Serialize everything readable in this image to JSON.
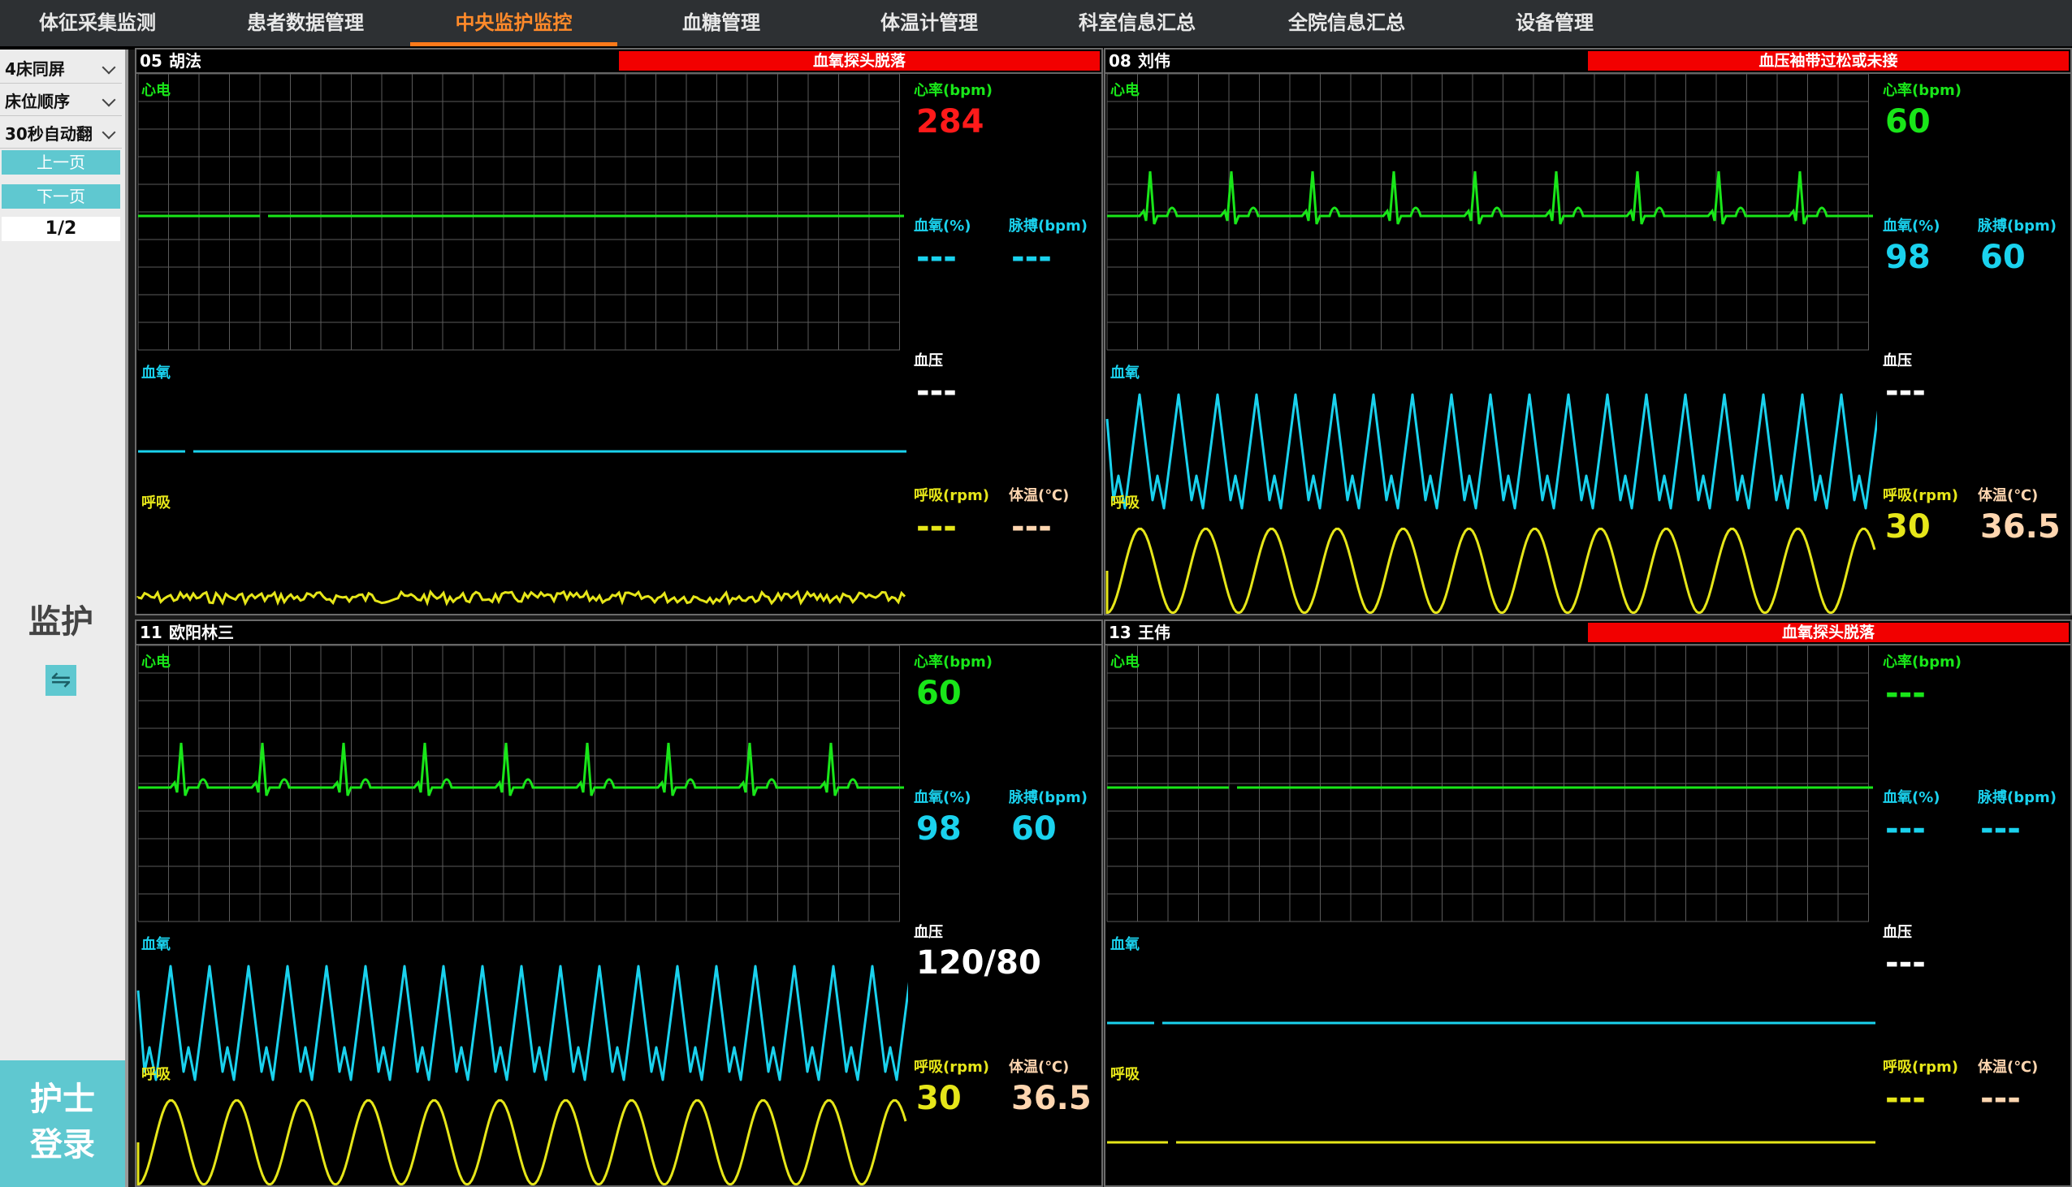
{
  "nav": {
    "tabs": [
      "体征采集监测",
      "患者数据管理",
      "中央监护监控",
      "血糖管理",
      "体温计管理",
      "科室信息汇总",
      "全院信息汇总",
      "设备管理"
    ],
    "active_index": 2
  },
  "sidebar": {
    "layout_select": "4床同屏",
    "order_select": "床位顺序",
    "flip_select": "30秒自动翻",
    "prev_page": "上一页",
    "next_page": "下一页",
    "page_indicator": "1/2",
    "monitor_label": "监护",
    "swap_icon": "⇋",
    "nurse_login_line1": "护士",
    "nurse_login_line2": "登录"
  },
  "labels": {
    "ecg": "心电",
    "spo2_wave": "血氧",
    "resp_wave": "呼吸",
    "hr": "心率(bpm)",
    "spo2": "血氧(%)",
    "pulse": "脉搏(bpm)",
    "bp": "血压",
    "resp": "呼吸(rpm)",
    "temp": "体温(℃)"
  },
  "colors": {
    "ecg": "#19e619",
    "spo2": "#1ad2ee",
    "resp": "#e6e619",
    "alarm": "#f20000",
    "hr_alarm": "#ff1a1a",
    "active_tab": "#ff8a2a",
    "sidebar_button": "#5fc8d0"
  },
  "patients": [
    {
      "bed": "05",
      "name": "胡法",
      "alarm": "血氧探头脱落",
      "hr": "284",
      "hr_alarm": true,
      "spo2": "---",
      "pulse": "---",
      "bp": "---",
      "resp": "---",
      "temp": "---",
      "ecg_mode": "flat",
      "spo2_mode": "flat",
      "resp_mode": "noise"
    },
    {
      "bed": "08",
      "name": "刘伟",
      "alarm": "血压袖带过松或未接",
      "hr": "60",
      "hr_alarm": false,
      "spo2": "98",
      "pulse": "60",
      "bp": "---",
      "resp": "30",
      "temp": "36.5",
      "ecg_mode": "beat",
      "spo2_mode": "pleth",
      "resp_mode": "sine"
    },
    {
      "bed": "11",
      "name": "欧阳林三",
      "alarm": "",
      "hr": "60",
      "hr_alarm": false,
      "spo2": "98",
      "pulse": "60",
      "bp": "120/80",
      "resp": "30",
      "temp": "36.5",
      "ecg_mode": "beat",
      "spo2_mode": "pleth",
      "resp_mode": "sine"
    },
    {
      "bed": "13",
      "name": "王伟",
      "alarm": "血氧探头脱落",
      "hr": "---",
      "hr_alarm": false,
      "spo2": "---",
      "pulse": "---",
      "bp": "---",
      "resp": "---",
      "temp": "---",
      "ecg_mode": "flat",
      "spo2_mode": "flat",
      "resp_mode": "flat"
    }
  ]
}
